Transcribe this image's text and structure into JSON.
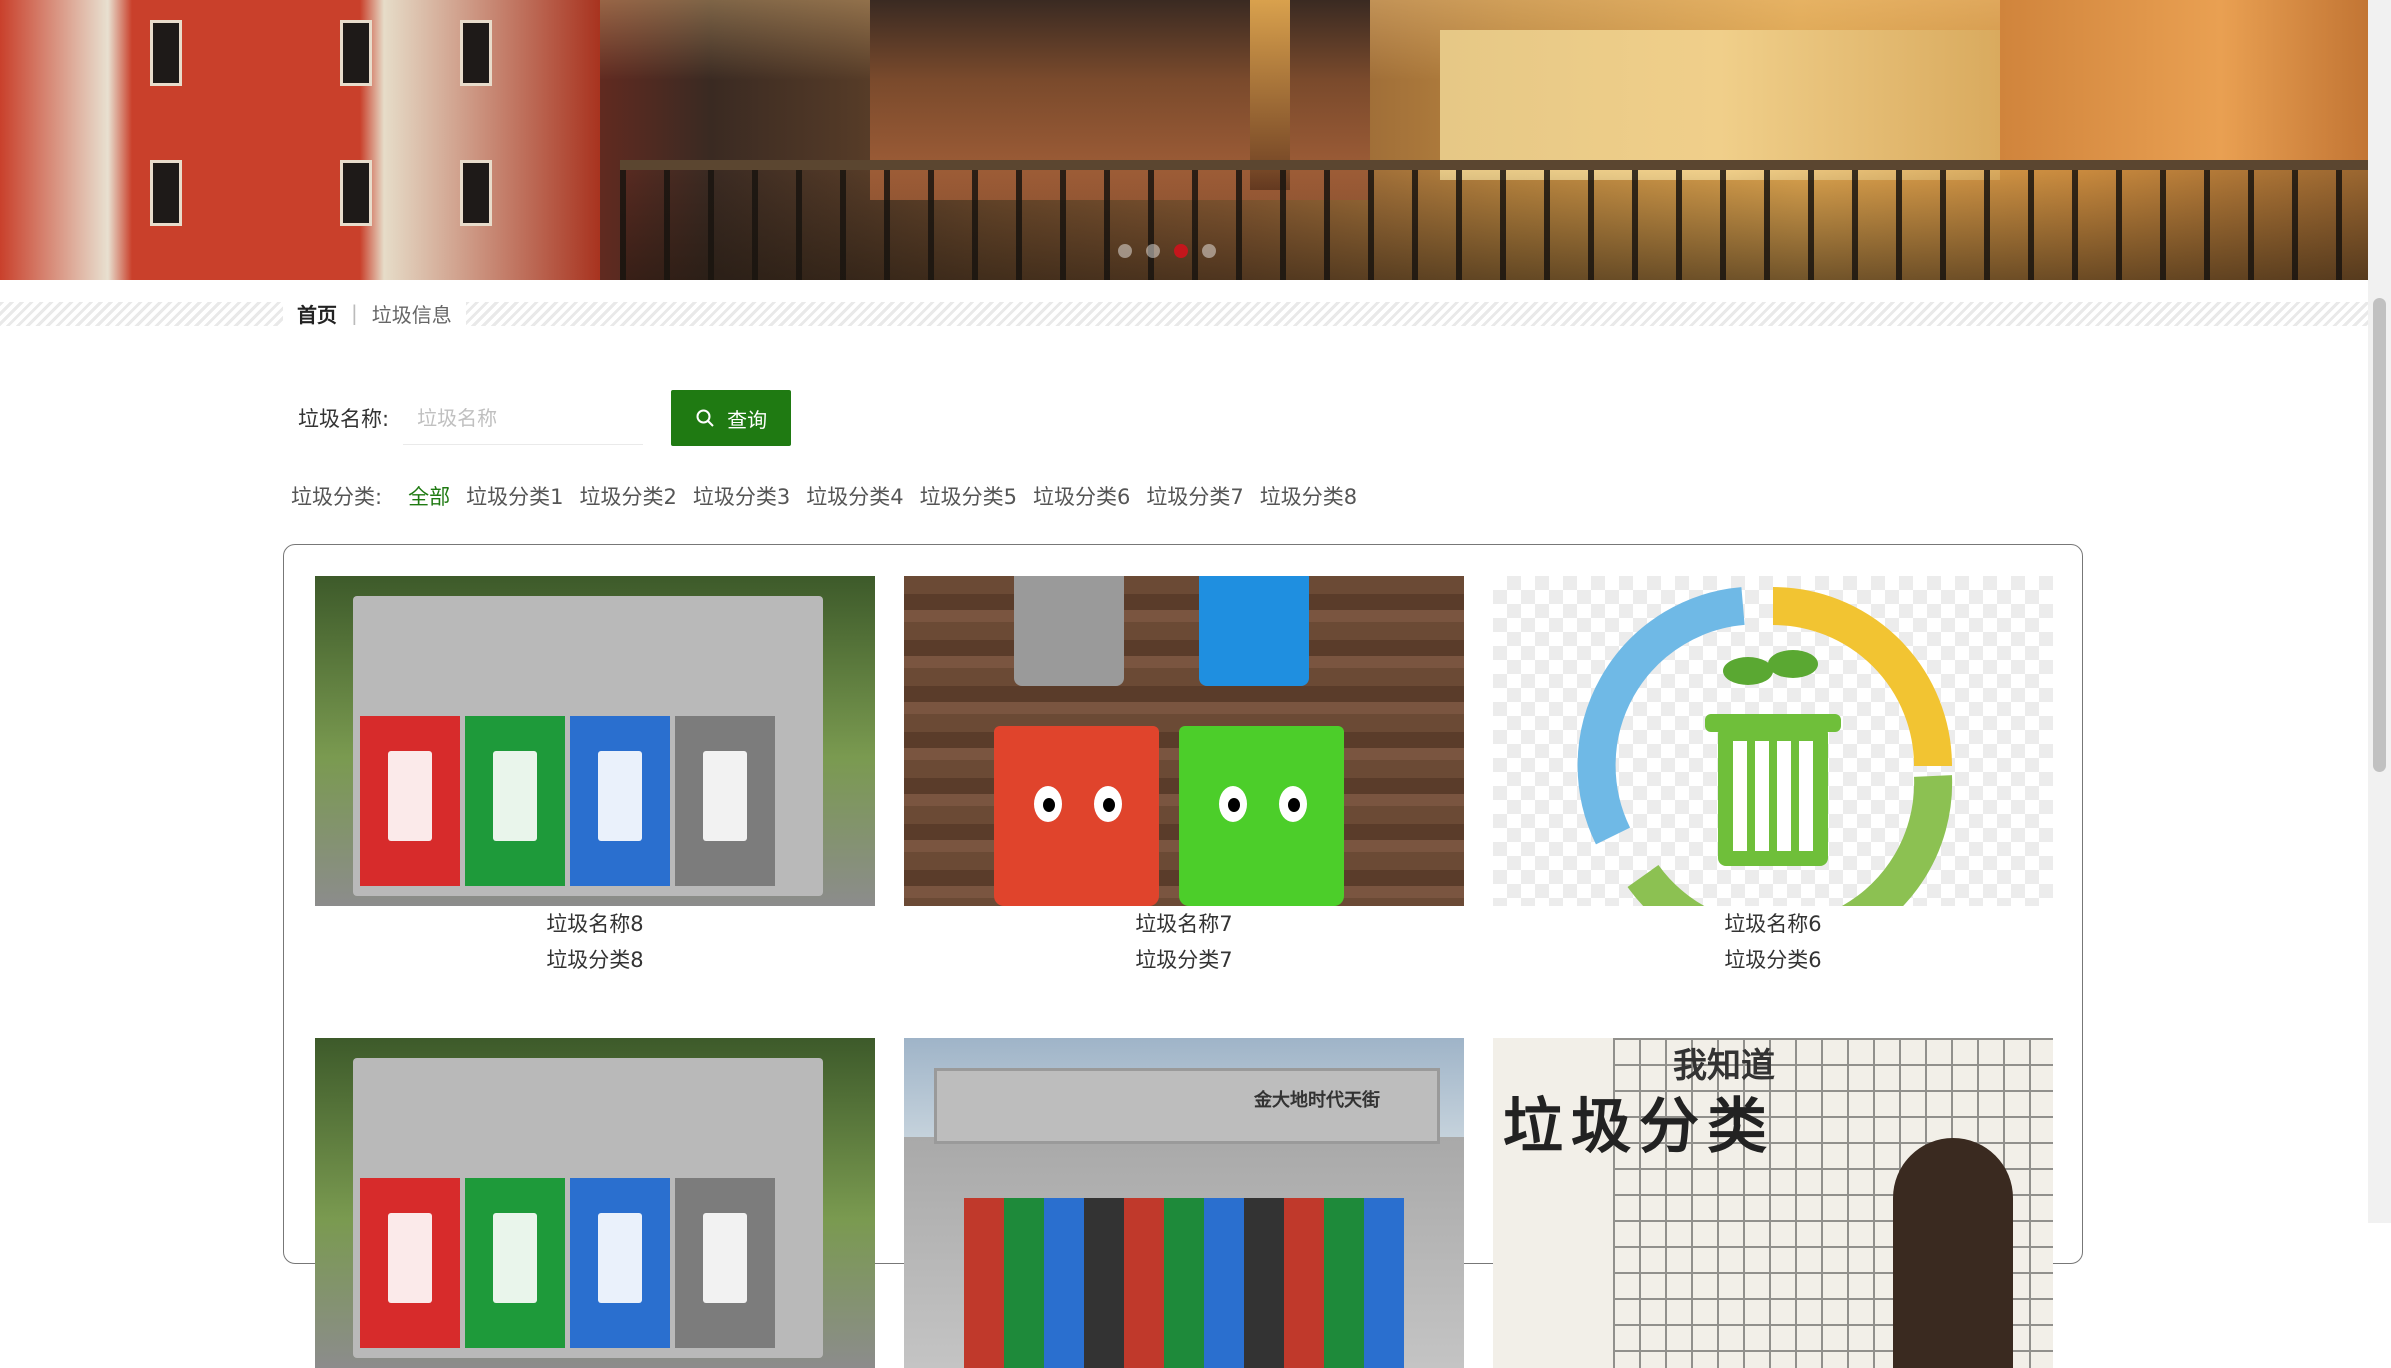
{
  "breadcrumb": {
    "home": "首页",
    "current": "垃圾信息"
  },
  "search": {
    "label": "垃圾名称:",
    "placeholder": "垃圾名称",
    "value": "",
    "button_label": "查询"
  },
  "categories": {
    "label": "垃圾分类:",
    "items": [
      "全部",
      "垃圾分类1",
      "垃圾分类2",
      "垃圾分类3",
      "垃圾分类4",
      "垃圾分类5",
      "垃圾分类6",
      "垃圾分类7",
      "垃圾分类8"
    ],
    "selected": "全部"
  },
  "cards": [
    {
      "name": "垃圾名称8",
      "category": "垃圾分类8",
      "image": "sorting-bins-photo"
    },
    {
      "name": "垃圾名称7",
      "category": "垃圾分类7",
      "image": "cartoon-bins-photo"
    },
    {
      "name": "垃圾名称6",
      "category": "垃圾分类6",
      "image": "recycle-bin-icon-image"
    },
    {
      "name": "",
      "category": "",
      "image": "sorting-bins-photo"
    },
    {
      "name": "",
      "category": "",
      "image": "sorting-station-photo"
    },
    {
      "name": "",
      "category": "",
      "image": "classroom-board-photo"
    }
  ],
  "images": {
    "station_sign": "金大地时代天街",
    "board_text": "垃圾分类",
    "board_text2": "我知道"
  },
  "theme": {
    "accent": "#1f7a12",
    "active_dot": "#c4161c"
  },
  "banner": {
    "slide_count": 4,
    "active_slide": 3
  }
}
